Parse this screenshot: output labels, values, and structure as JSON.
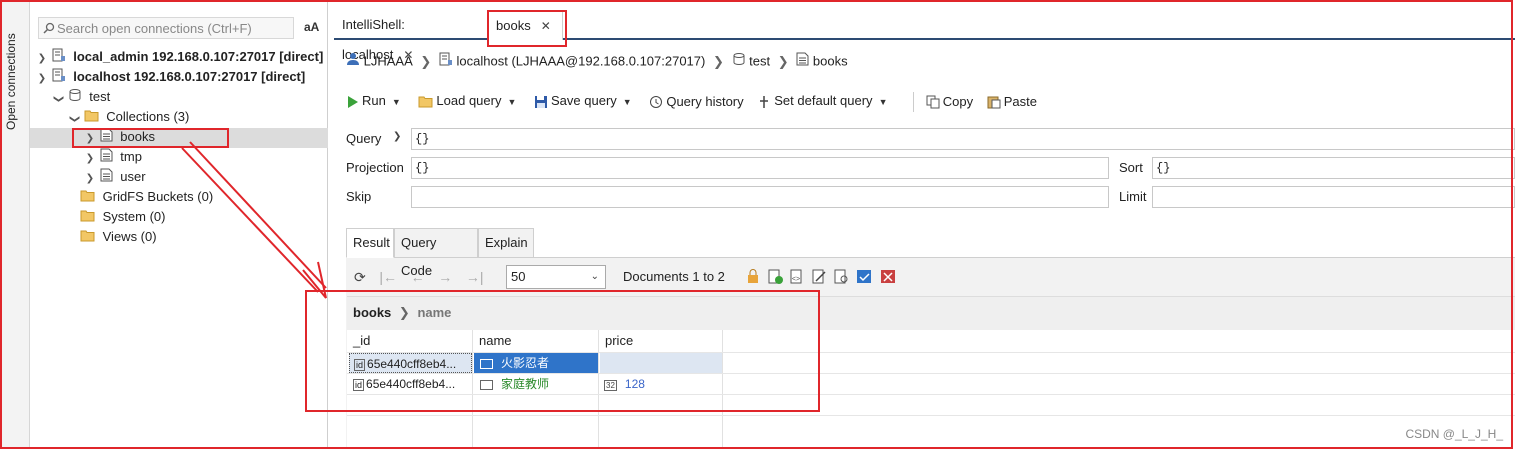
{
  "sidebar_tab": {
    "label": "Open connections"
  },
  "explorer": {
    "search_placeholder": "Search open connections (Ctrl+F)",
    "font_toggle": "aA",
    "connections": [
      {
        "label": "local_admin 192.168.0.107:27017 [direct]",
        "expanded": false
      },
      {
        "label": "localhost 192.168.0.107:27017 [direct]",
        "expanded": true
      }
    ],
    "database": "test",
    "collections_group": "Collections (3)",
    "collections": [
      "books",
      "tmp",
      "user"
    ],
    "other_groups": [
      "GridFS Buckets (0)",
      "System (0)",
      "Views (0)"
    ]
  },
  "tabs": [
    {
      "label": "IntelliShell: localhost",
      "active": false
    },
    {
      "label": "books",
      "active": true
    }
  ],
  "breadcrumb": {
    "user": "LJHAAA",
    "server": "localhost (LJHAAA@192.168.0.107:27017)",
    "database": "test",
    "collection": "books"
  },
  "toolbar": {
    "run": "Run",
    "load_query": "Load query",
    "save_query": "Save query",
    "query_history": "Query history",
    "set_default_query": "Set default query",
    "copy": "Copy",
    "paste": "Paste"
  },
  "query_panel": {
    "query_label": "Query",
    "query_value": "{}",
    "projection_label": "Projection",
    "projection_value": "{}",
    "sort_label": "Sort",
    "sort_value": "{}",
    "skip_label": "Skip",
    "skip_value": "",
    "limit_label": "Limit",
    "limit_value": ""
  },
  "result_tabs": [
    "Result",
    "Query Code",
    "Explain"
  ],
  "pager": {
    "page_size": "50",
    "documents_text": "Documents 1 to 2"
  },
  "grid_path": {
    "root": "books",
    "field": "name"
  },
  "grid": {
    "columns": [
      "_id",
      "name",
      "price"
    ],
    "rows": [
      {
        "_id": "65e440cff8eb4...",
        "name": "火影忍者",
        "price": ""
      },
      {
        "_id": "65e440cff8eb4...",
        "name": "家庭教师",
        "price": "128"
      }
    ]
  },
  "watermark": "CSDN @_L_J_H_",
  "colors": {
    "accent": "#2d4b73",
    "selection": "#2f74c9",
    "annotation_red": "#e0262b",
    "string_green": "#2a8a2a",
    "number_blue": "#3b66c9"
  }
}
